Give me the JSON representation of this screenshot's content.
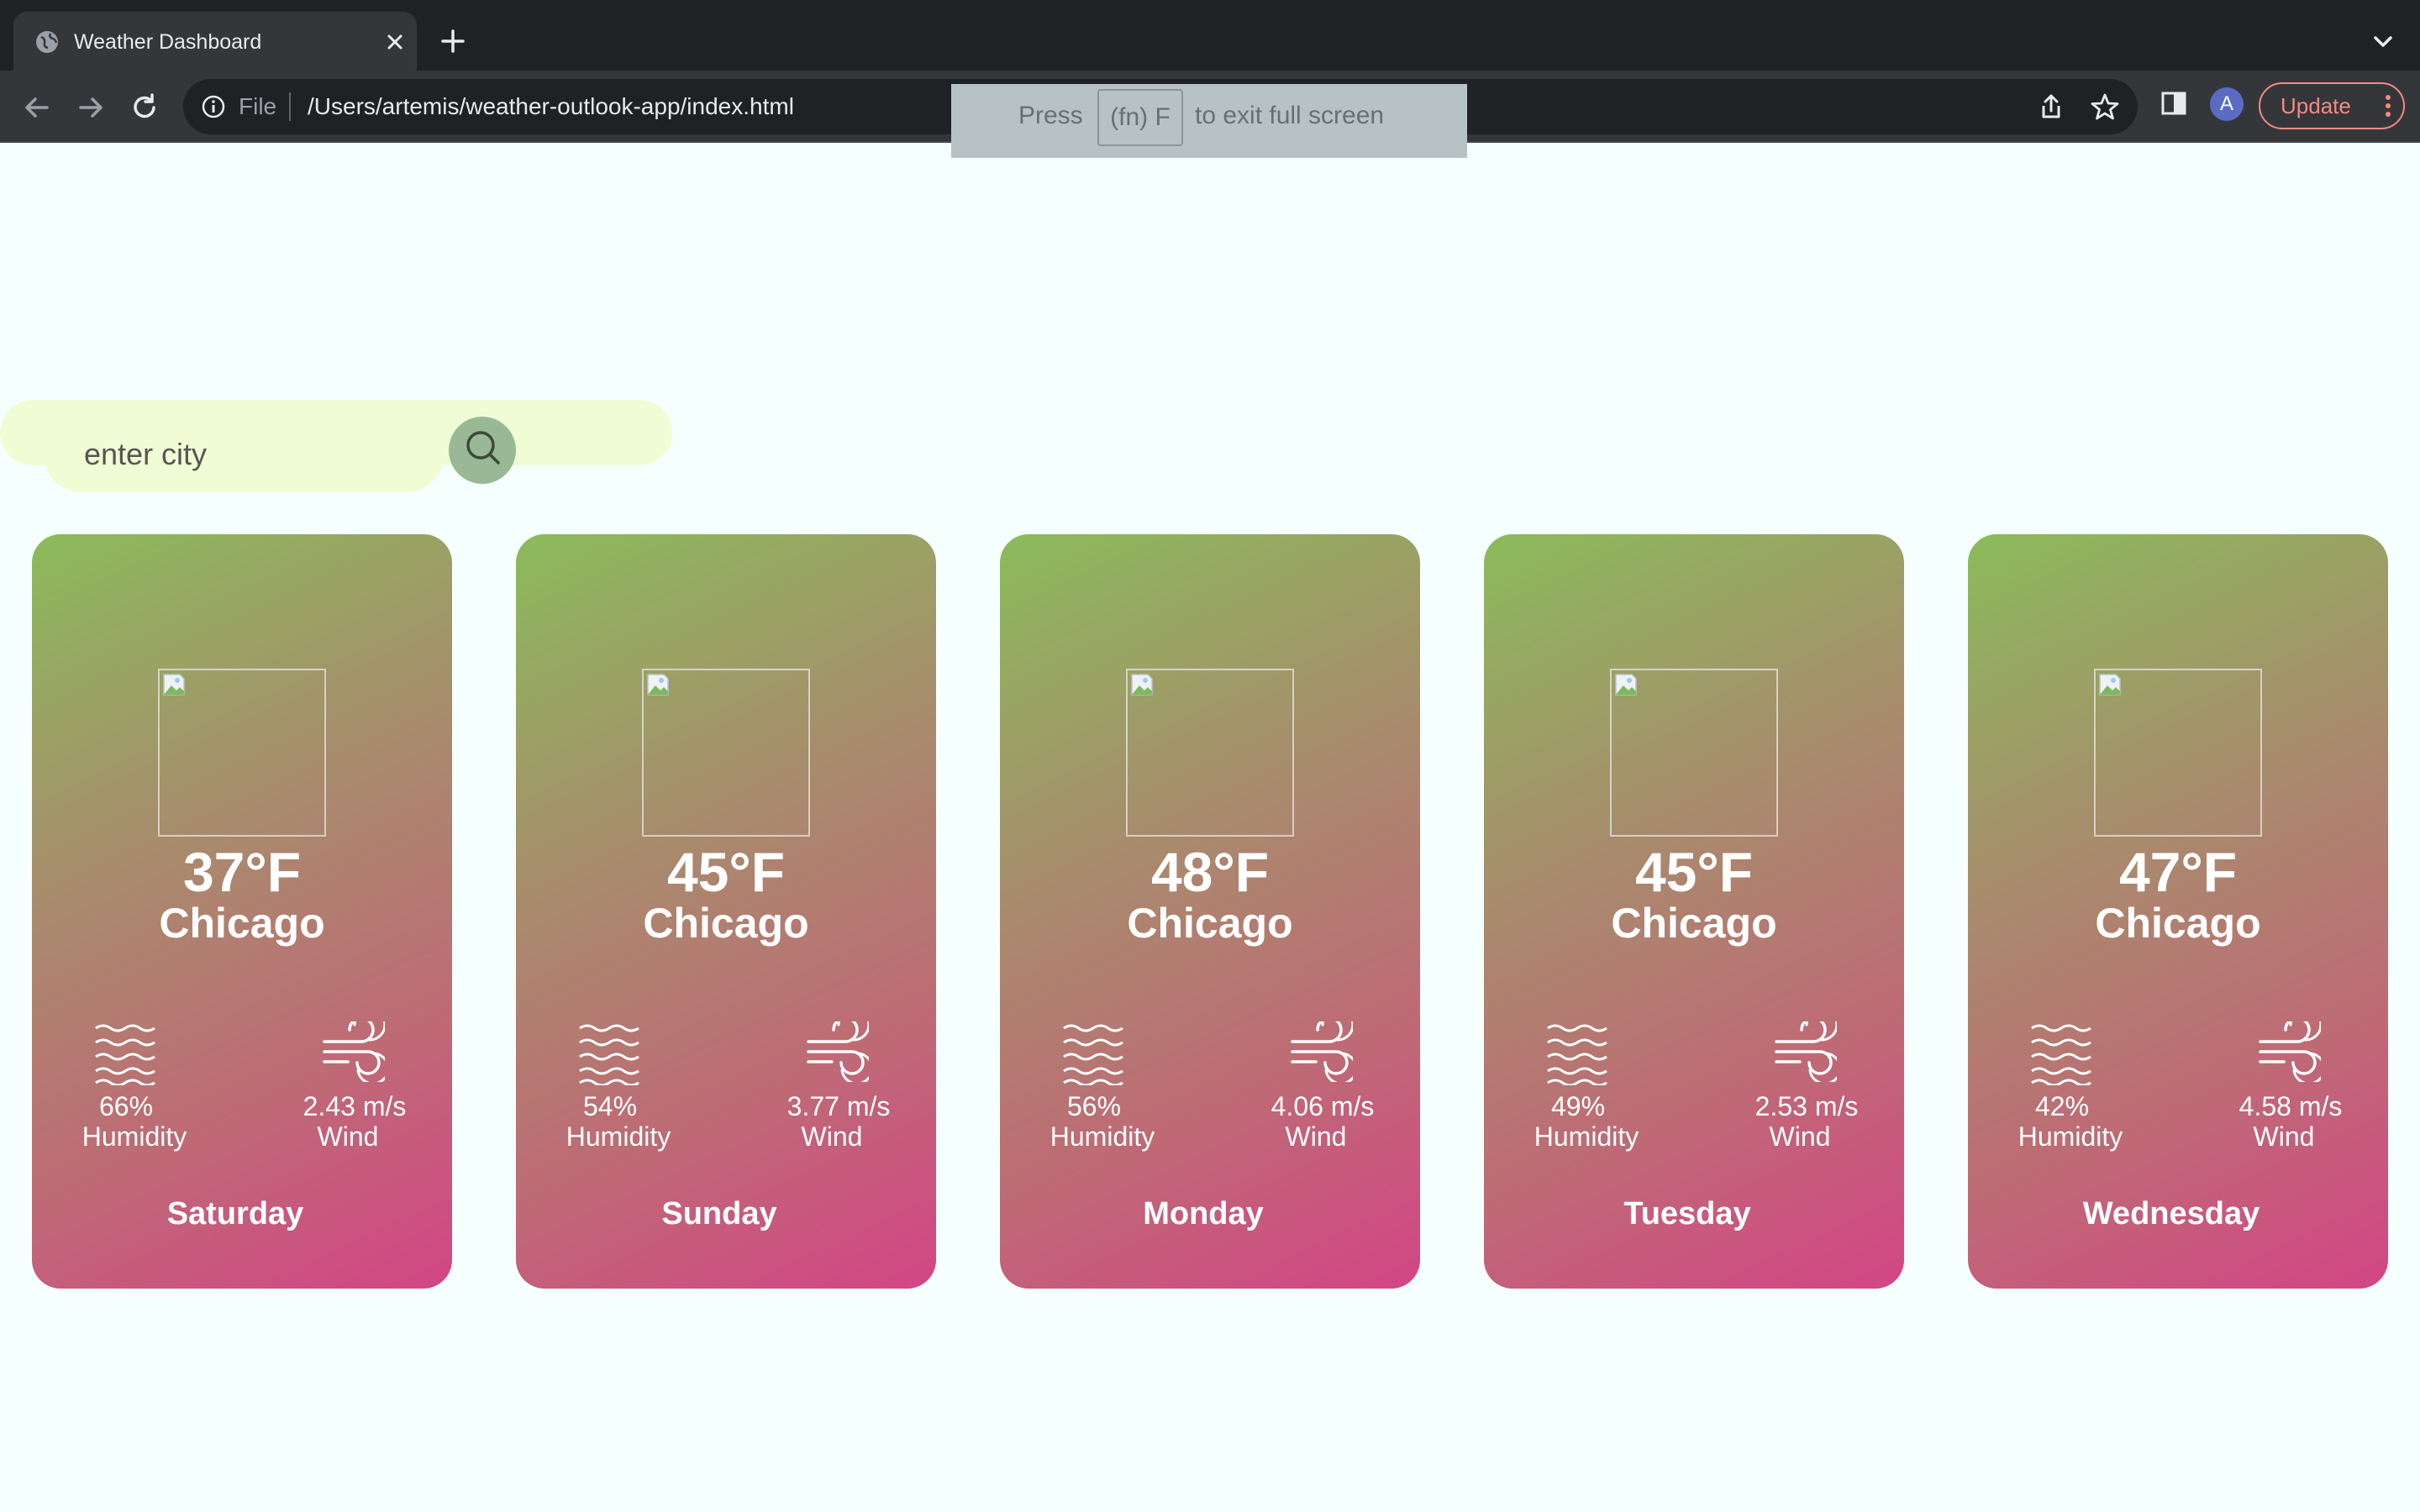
{
  "browser": {
    "tab_title": "Weather Dashboard",
    "file_label": "File",
    "url": "/Users/artemis/weather-outlook-app/index.html",
    "avatar_letter": "A",
    "update_label": "Update",
    "fullscreen_hint": {
      "press": "Press",
      "key": "(fn) F",
      "rest": "to exit full screen"
    }
  },
  "search": {
    "placeholder": "enter city",
    "icon": "search-icon"
  },
  "colors": {
    "page_bg": "#f5fffd",
    "search_bg": "#f0fcd4",
    "search_btn": "#99b896",
    "card_gradient_start": "#8bbb5b",
    "card_gradient_end": "#d34586"
  },
  "forecast": [
    {
      "temp": "37°F",
      "city": "Chicago",
      "humidity": "66%",
      "humidity_label": "Humidity",
      "wind": "2.43 m/s",
      "wind_label": "Wind",
      "day": "Saturday"
    },
    {
      "temp": "45°F",
      "city": "Chicago",
      "humidity": "54%",
      "humidity_label": "Humidity",
      "wind": "3.77 m/s",
      "wind_label": "Wind",
      "day": "Sunday"
    },
    {
      "temp": "48°F",
      "city": "Chicago",
      "humidity": "56%",
      "humidity_label": "Humidity",
      "wind": "4.06 m/s",
      "wind_label": "Wind",
      "day": "Monday"
    },
    {
      "temp": "45°F",
      "city": "Chicago",
      "humidity": "49%",
      "humidity_label": "Humidity",
      "wind": "2.53 m/s",
      "wind_label": "Wind",
      "day": "Tuesday"
    },
    {
      "temp": "47°F",
      "city": "Chicago",
      "humidity": "42%",
      "humidity_label": "Humidity",
      "wind": "4.58 m/s",
      "wind_label": "Wind",
      "day": "Wednesday"
    }
  ]
}
